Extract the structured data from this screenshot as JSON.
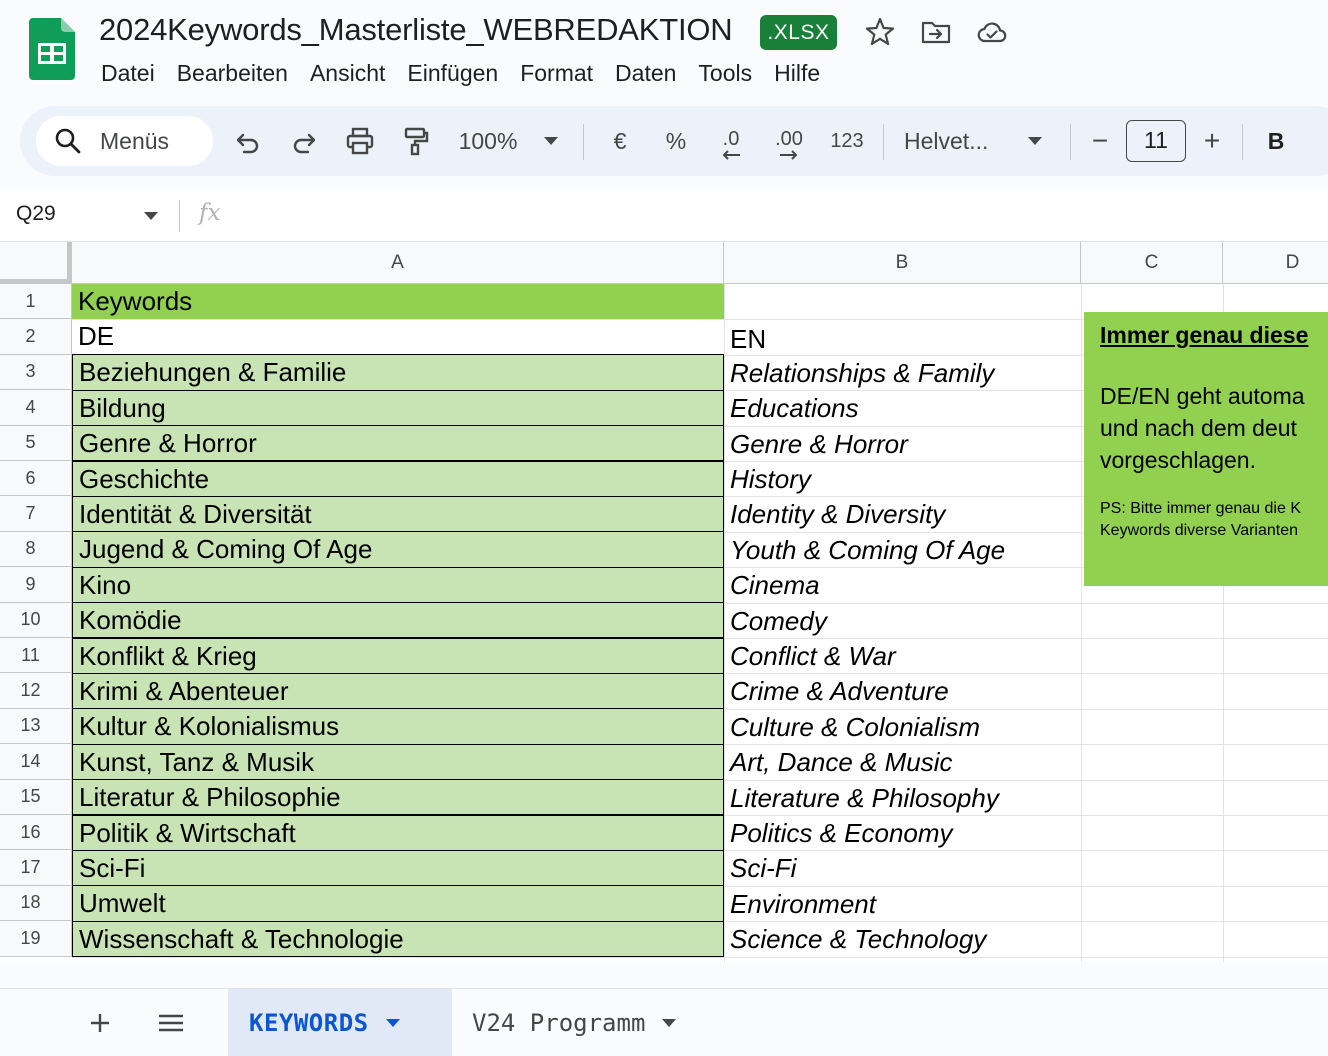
{
  "header": {
    "title": "2024Keywords_Masterliste_WEBREDAKTION",
    "badge": ".XLSX",
    "menu": [
      "Datei",
      "Bearbeiten",
      "Ansicht",
      "Einfügen",
      "Format",
      "Daten",
      "Tools",
      "Hilfe"
    ]
  },
  "toolbar": {
    "search_label": "Menüs",
    "zoom": "100%",
    "currency": "€",
    "percent": "%",
    "dec_decrease": ".0",
    "dec_increase": ".00",
    "number_format": "123",
    "font": "Helvet...",
    "font_size": "11",
    "minus": "−",
    "plus": "+",
    "bold": "B"
  },
  "formula_bar": {
    "cell_ref": "Q29",
    "fx": "fx"
  },
  "grid": {
    "columns": [
      "A",
      "B",
      "C",
      "D"
    ],
    "rows": [
      "1",
      "2",
      "3",
      "4",
      "5",
      "6",
      "7",
      "8",
      "9",
      "10",
      "11",
      "12",
      "13",
      "14",
      "15",
      "16",
      "17",
      "18",
      "19"
    ],
    "a1": "Keywords",
    "a2": "DE",
    "b2": "EN",
    "keywords_de": [
      "Beziehungen & Familie",
      "Bildung",
      "Genre & Horror",
      "Geschichte",
      "Identität & Diversität",
      "Jugend & Coming Of Age",
      "Kino",
      "Komödie",
      "Konflikt & Krieg",
      "Krimi & Abenteuer",
      "Kultur & Kolonialismus",
      "Kunst, Tanz & Musik",
      "Literatur & Philosophie",
      "Politik & Wirtschaft",
      "Sci-Fi",
      "Umwelt",
      "Wissenschaft & Technologie"
    ],
    "keywords_en": [
      "Relationships & Family",
      "Educations",
      "Genre & Horror",
      "History",
      "Identity & Diversity",
      "Youth & Coming Of Age",
      "Cinema",
      "Comedy",
      "Conflict & War",
      "Crime & Adventure",
      "Culture & Colonialism",
      "Art, Dance & Music",
      "Literature & Philosophy",
      "Politics & Economy",
      "Sci-Fi",
      "Environment",
      "Science & Technology"
    ],
    "note": {
      "title": "Immer genau diese",
      "lines": [
        "DE/EN geht automa",
        "und nach dem deut",
        "vorgeschlagen."
      ],
      "ps_lines": [
        "PS: Bitte immer genau die K",
        "Keywords diverse Varianten"
      ]
    }
  },
  "sheets": {
    "tabs": [
      {
        "label": "KEYWORDS",
        "active": true
      },
      {
        "label": "V24 Programm",
        "active": false
      }
    ]
  },
  "colors": {
    "header_green": "#92d050",
    "cell_green": "#c9e4b4",
    "active_tab": "#0b57d0",
    "badge_green": "#188038"
  }
}
